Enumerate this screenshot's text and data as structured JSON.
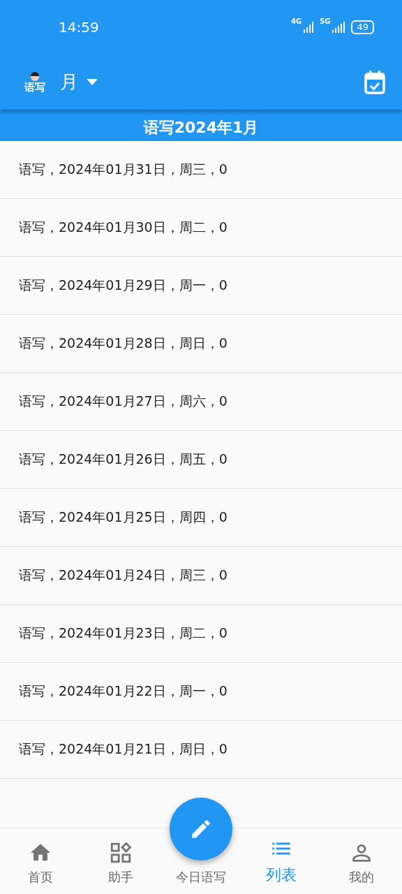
{
  "status_bar": {
    "time": "14:59",
    "network_1": "4G",
    "network_2": "5G",
    "battery": "49"
  },
  "app_bar": {
    "logo_text": "语写",
    "period": "月"
  },
  "subheader": "语写2024年1月",
  "rows": [
    {
      "text": "语写，2024年01月31日，周三，0"
    },
    {
      "text": "语写，2024年01月30日，周二，0"
    },
    {
      "text": "语写，2024年01月29日，周一，0"
    },
    {
      "text": "语写，2024年01月28日，周日，0"
    },
    {
      "text": "语写，2024年01月27日，周六，0"
    },
    {
      "text": "语写，2024年01月26日，周五，0"
    },
    {
      "text": "语写，2024年01月25日，周四，0"
    },
    {
      "text": "语写，2024年01月24日，周三，0"
    },
    {
      "text": "语写，2024年01月23日，周二，0"
    },
    {
      "text": "语写，2024年01月22日，周一，0"
    },
    {
      "text": "语写，2024年01月21日，周日，0"
    }
  ],
  "bottom_nav": [
    {
      "kind": "home",
      "label": "首页",
      "selected": false
    },
    {
      "kind": "apps",
      "label": "助手",
      "selected": false
    },
    {
      "kind": "write",
      "label": "今日语写",
      "selected": false
    },
    {
      "kind": "list",
      "label": "列表",
      "selected": true
    },
    {
      "kind": "person",
      "label": "我的",
      "selected": false
    }
  ]
}
